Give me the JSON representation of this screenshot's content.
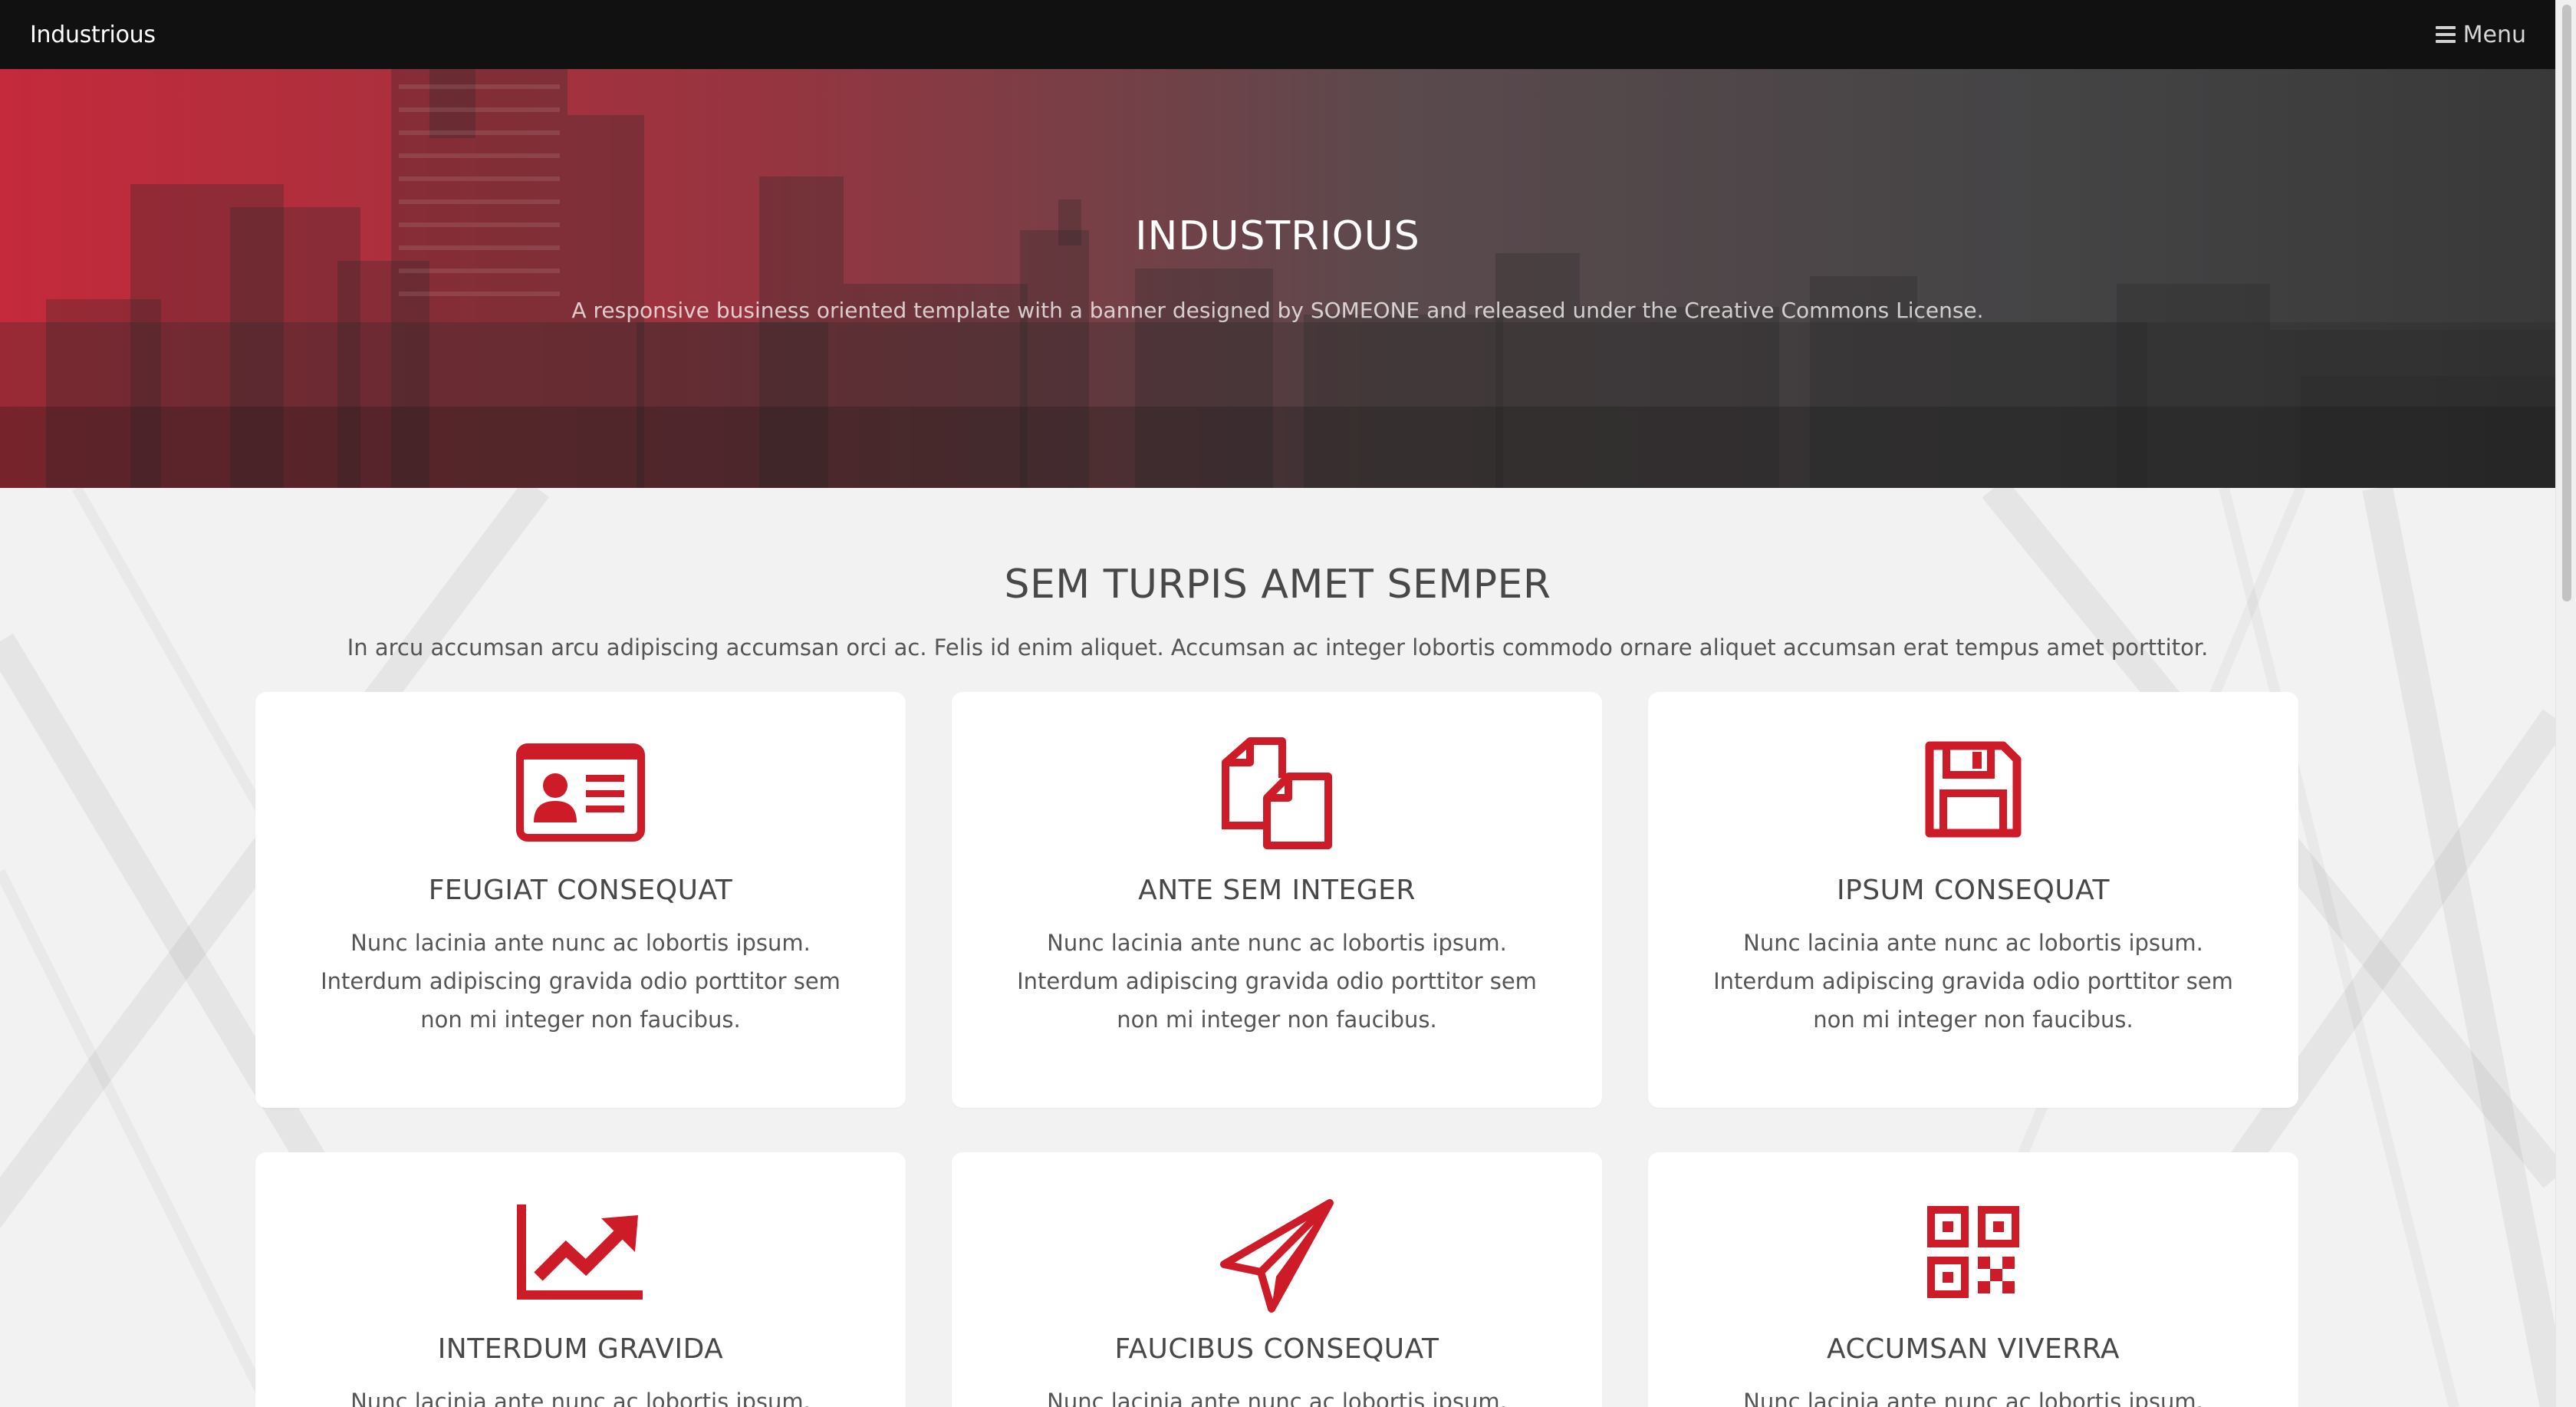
{
  "header": {
    "brand": "Industrious",
    "menu_label": "Menu"
  },
  "banner": {
    "title": "INDUSTRIOUS",
    "subtitle": "A responsive business oriented template with a banner designed by SOMEONE and released under the Creative Commons License."
  },
  "section": {
    "title": "SEM TURPIS AMET SEMPER",
    "description": "In arcu accumsan arcu adipiscing accumsan orci ac. Felis id enim aliquet. Accumsan ac integer lobortis commodo ornare aliquet accumsan erat tempus amet porttitor."
  },
  "cards": [
    {
      "icon": "id-card-icon",
      "title": "FEUGIAT CONSEQUAT",
      "text": "Nunc lacinia ante nunc ac lobortis ipsum. Interdum adipiscing gravida odio porttitor sem non mi integer non faucibus."
    },
    {
      "icon": "copy-files-icon",
      "title": "ANTE SEM INTEGER",
      "text": "Nunc lacinia ante nunc ac lobortis ipsum. Interdum adipiscing gravida odio porttitor sem non mi integer non faucibus."
    },
    {
      "icon": "floppy-disk-icon",
      "title": "IPSUM CONSEQUAT",
      "text": "Nunc lacinia ante nunc ac lobortis ipsum. Interdum adipiscing gravida odio porttitor sem non mi integer non faucibus."
    },
    {
      "icon": "chart-line-icon",
      "title": "INTERDUM GRAVIDA",
      "text": "Nunc lacinia ante nunc ac lobortis ipsum. Interdum"
    },
    {
      "icon": "paper-plane-icon",
      "title": "FAUCIBUS CONSEQUAT",
      "text": "Nunc lacinia ante nunc ac lobortis ipsum. Interdum"
    },
    {
      "icon": "qr-code-icon",
      "title": "ACCUMSAN VIVERRA",
      "text": "Nunc lacinia ante nunc ac lobortis ipsum. Interdum"
    }
  ],
  "colors": {
    "accent": "#ce1b28",
    "header_bg": "#111111"
  }
}
